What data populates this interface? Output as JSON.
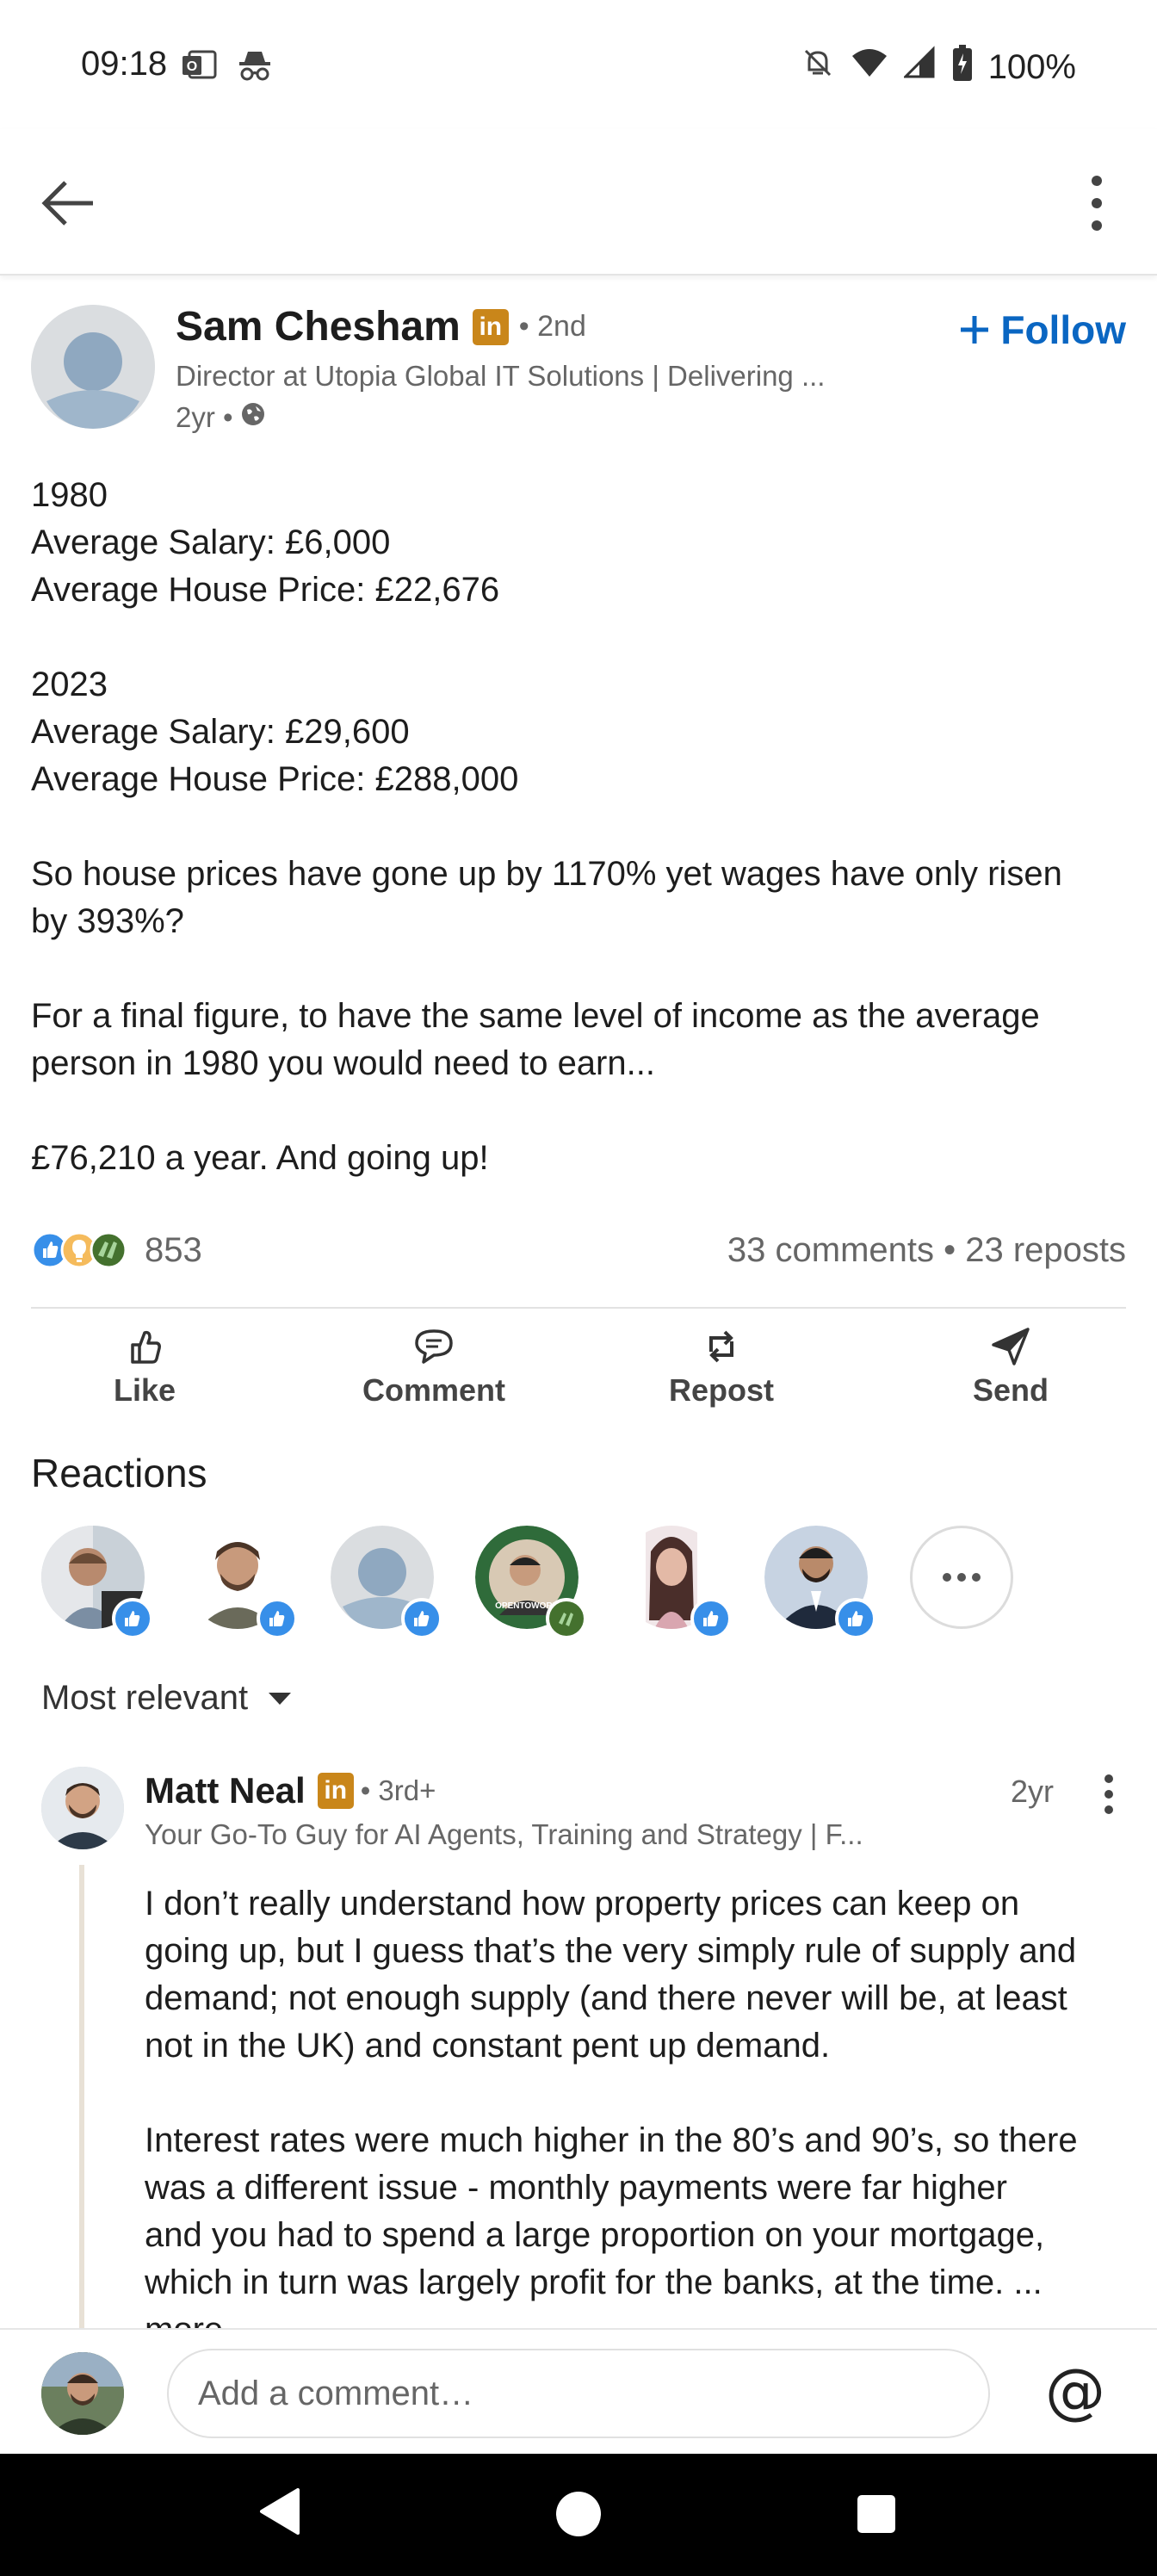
{
  "status_bar": {
    "time": "09:18",
    "battery": "100%",
    "left_icons": [
      "outlook-icon",
      "incognito-icon"
    ],
    "right_icons": [
      "mute-icon",
      "wifi-icon",
      "signal-icon",
      "battery-icon"
    ]
  },
  "app_bar": {
    "back_icon": "arrow-left-icon",
    "menu_icon": "more-vertical-icon"
  },
  "post": {
    "author": {
      "name": "Sam Chesham",
      "badge": "in",
      "degree": "• 2nd",
      "headline": "Director at Utopia Global IT Solutions | Delivering ...",
      "time": "2yr •",
      "visibility_icon": "globe-icon"
    },
    "follow_label": "Follow",
    "body": [
      [
        "1980",
        "Average Salary: £6,000",
        "Average House Price: £22,676"
      ],
      [
        "2023",
        "Average Salary: £29,600",
        "Average House Price: £288,000"
      ],
      [
        "So house prices have gone up by 1170% yet wages have only risen",
        "by 393%?"
      ],
      [
        "For a final figure, to have the same level of income as the average",
        "person in 1980 you would need to earn..."
      ],
      [
        "£76,210 a year. And going up!"
      ]
    ],
    "reaction_count": "853",
    "comments_reposts": "33 comments • 23 reposts",
    "actions": {
      "like": "Like",
      "comment": "Comment",
      "repost": "Repost",
      "send": "Send"
    }
  },
  "reactions": {
    "title": "Reactions",
    "colors": {
      "like": "#378fe9",
      "insight": "#f5bb5c",
      "support": "#44712e"
    }
  },
  "sort": {
    "label": "Most relevant"
  },
  "comment": {
    "author": "Matt Neal",
    "badge": "in",
    "degree": "• 3rd+",
    "time": "2yr",
    "headline": "Your Go-To Guy for AI Agents, Training and Strategy | F...",
    "paragraphs": [
      [
        "I don’t really understand how property prices can keep on",
        "going up, but I guess that’s the very simply rule of supply and",
        "demand; not enough supply (and there never will be, at least",
        "not in the UK) and constant pent up demand."
      ],
      [
        "Interest rates were much higher in the 80’s and 90’s, so there",
        "was a different issue - monthly payments were far higher",
        "and you had to spend a large proportion on your mortgage,",
        "which in turn was largely profit for the banks, at the time. ...",
        "more"
      ]
    ]
  },
  "comment_input": {
    "placeholder": "Add a comment…",
    "mention_symbol": "@"
  },
  "theme": {
    "brand_blue": "#0a66c2",
    "premium_gold": "#c9861a"
  }
}
